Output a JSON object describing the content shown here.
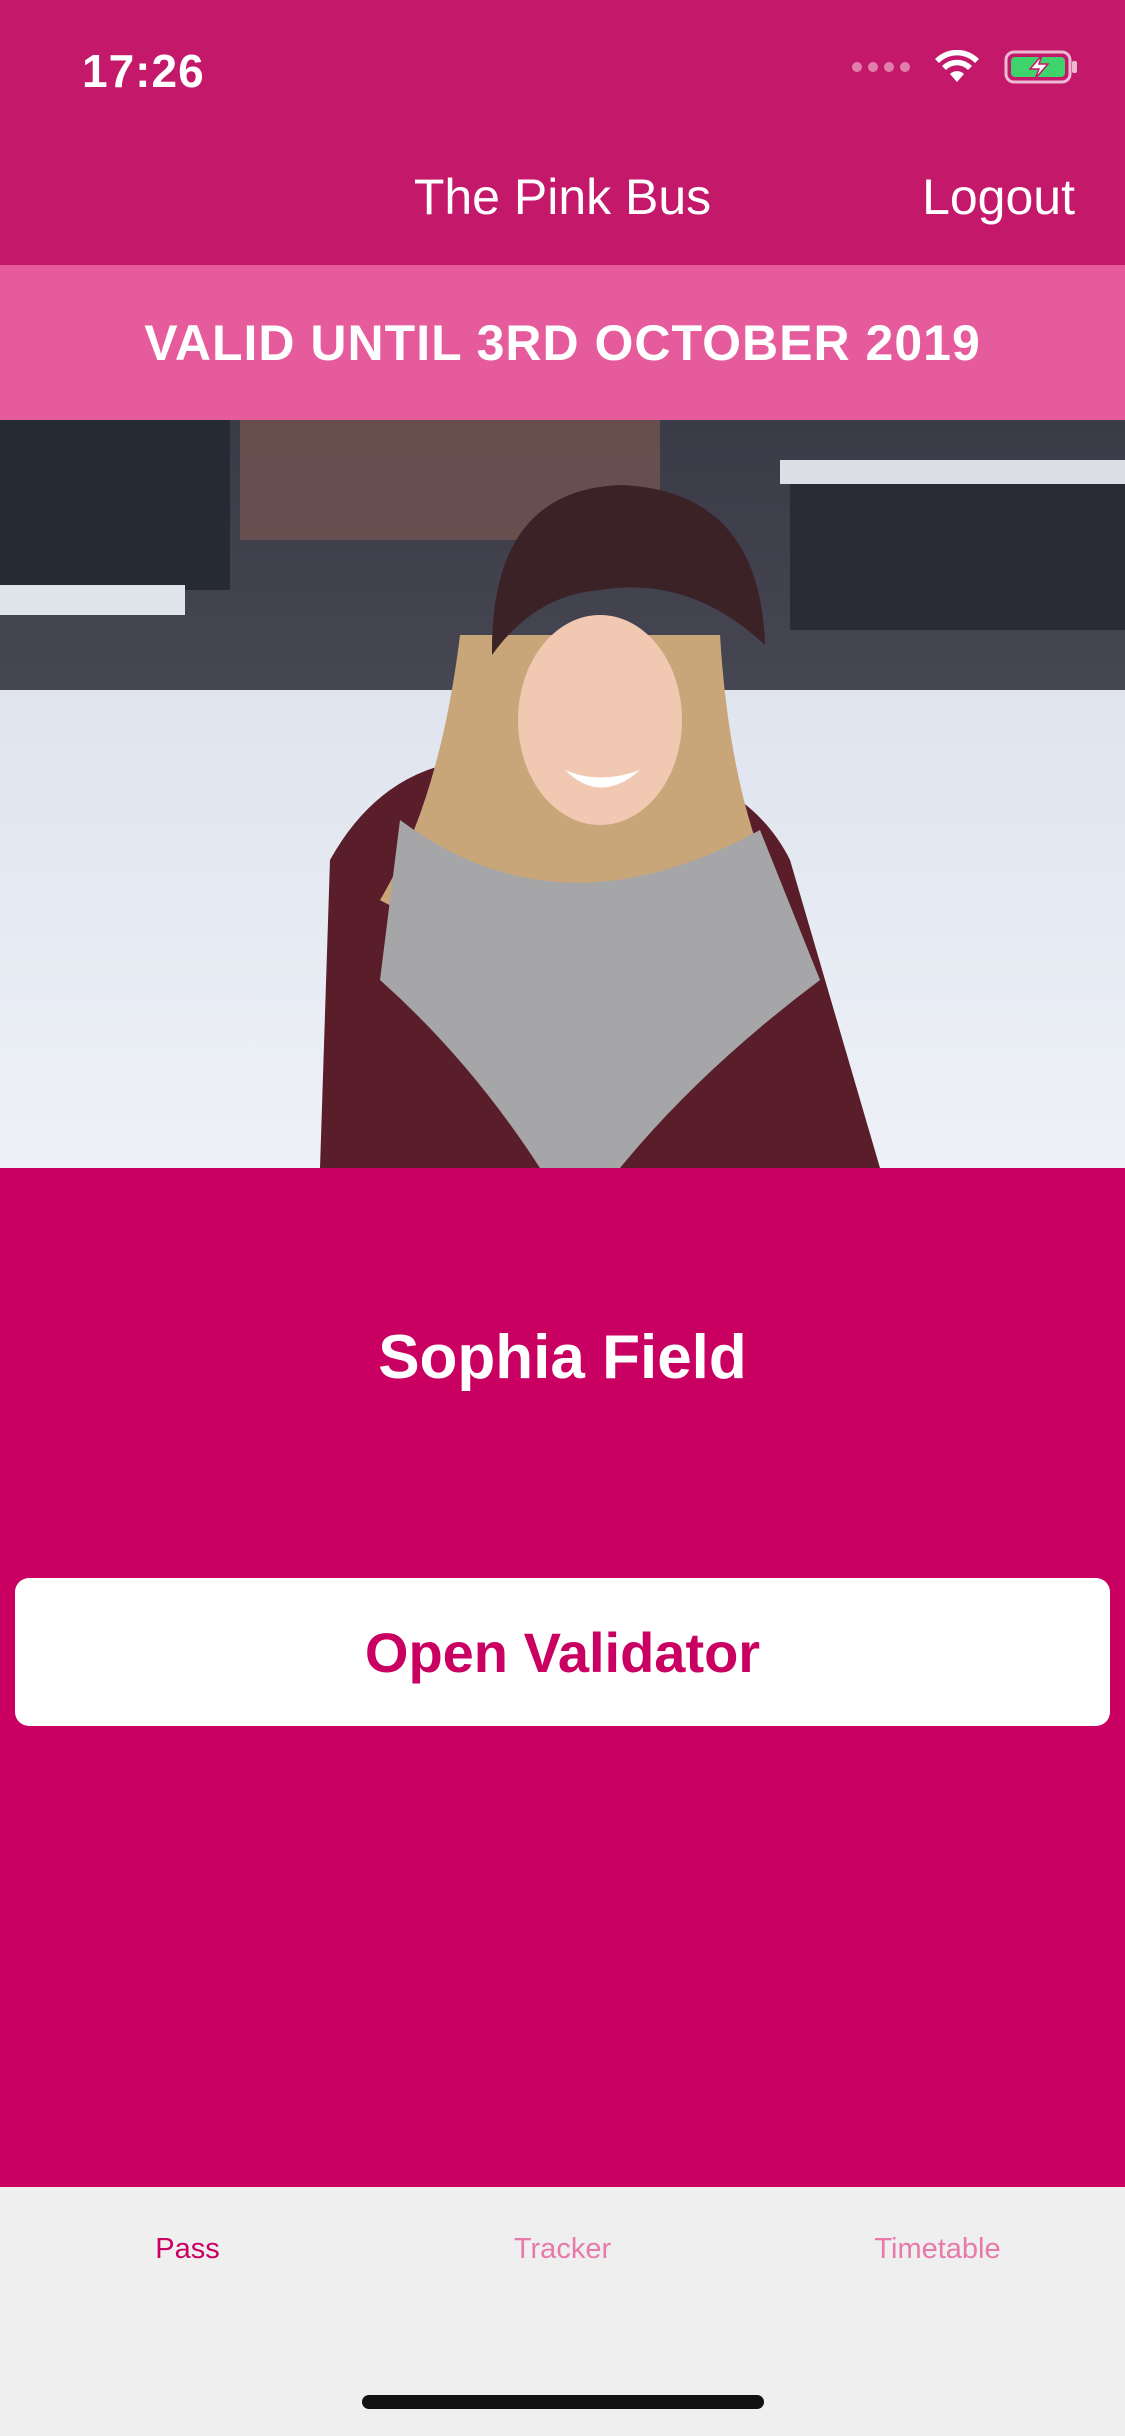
{
  "status_bar": {
    "time": "17:26",
    "icons": [
      "signal-dots-icon",
      "wifi-icon",
      "battery-charging-icon"
    ]
  },
  "nav": {
    "title": "The Pink Bus",
    "logout_label": "Logout"
  },
  "pass": {
    "validity": "VALID UNTIL 3RD OCTOBER 2019",
    "name": "Sophia Field",
    "validator_button_label": "Open Validator"
  },
  "tabs": [
    {
      "label": "Pass",
      "active": true
    },
    {
      "label": "Tracker",
      "active": false
    },
    {
      "label": "Timetable",
      "active": false
    }
  ],
  "colors": {
    "header": "#c4196b",
    "banner": "#e65b9c",
    "main": "#c90061",
    "tab_active": "#c90061",
    "tab_inactive": "#e77aaa",
    "tabbar_bg": "#efefef"
  }
}
